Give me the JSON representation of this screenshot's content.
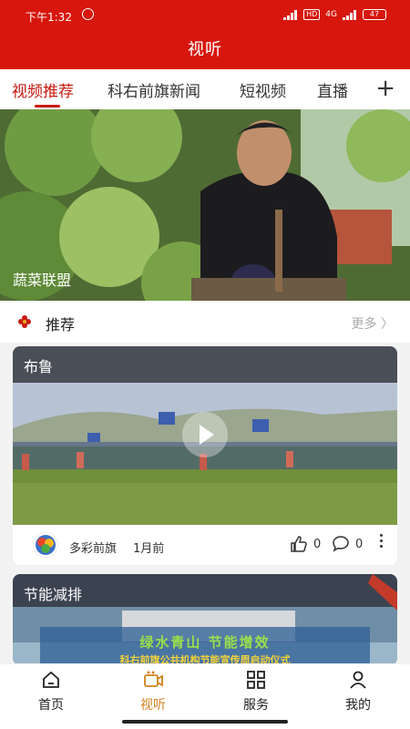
{
  "status_bar": {
    "time": "下午1:32",
    "network": "4G",
    "hd": "HD",
    "battery": "47"
  },
  "header": {
    "title": "视听"
  },
  "tabs": [
    {
      "label": "视频推荐",
      "active": true
    },
    {
      "label": "科右前旗新闻",
      "active": false
    },
    {
      "label": "短视频",
      "active": false
    },
    {
      "label": "直播",
      "active": false
    }
  ],
  "tabs_add_icon": "plus-icon",
  "hero": {
    "caption": "蔬菜联盟"
  },
  "recommend": {
    "label": "推荐",
    "more": "更多 〉"
  },
  "videos": [
    {
      "title": "布鲁",
      "source": "多彩前旗",
      "time": "1月前",
      "likes": "0",
      "comments": "0"
    },
    {
      "title": "节能减排",
      "banner_line1": "绿水青山 节能增效",
      "banner_line2": "科右前旗公共机构节能宣传周启动仪式"
    }
  ],
  "bottom_nav": [
    {
      "label": "首页",
      "icon": "home-icon",
      "active": false
    },
    {
      "label": "视听",
      "icon": "video-icon",
      "active": true
    },
    {
      "label": "服务",
      "icon": "grid-icon",
      "active": false
    },
    {
      "label": "我的",
      "icon": "user-icon",
      "active": false
    }
  ],
  "colors": {
    "brand_red": "#d7160d",
    "nav_active": "#d0811e"
  }
}
